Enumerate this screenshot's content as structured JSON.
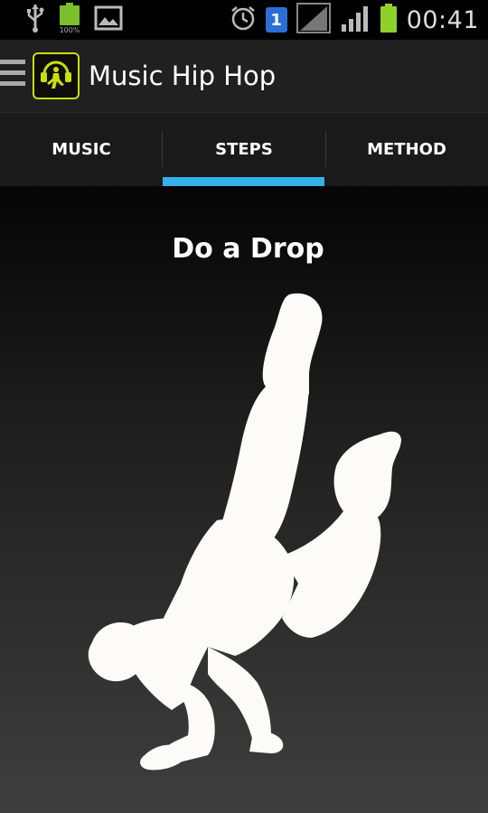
{
  "status_bar": {
    "time": "00:41",
    "sim_slot": "1",
    "battery_level_label": "100%",
    "icons": [
      "usb-icon",
      "battery-icon",
      "image-icon",
      "alarm-icon",
      "sim-icon",
      "no-signal-icon",
      "signal-icon",
      "battery-charging-icon"
    ]
  },
  "action_bar": {
    "title": "Music Hip Hop",
    "icon": "headphone-dancer-logo",
    "accent": "#c8e000"
  },
  "tabs": [
    {
      "label": "MUSIC",
      "selected": false
    },
    {
      "label": "STEPS",
      "selected": true
    },
    {
      "label": "METHOD",
      "selected": false
    }
  ],
  "tab_indicator_color": "#35b1e8",
  "content": {
    "title": "Do a Drop",
    "image": "breakdancer-silhouette"
  }
}
